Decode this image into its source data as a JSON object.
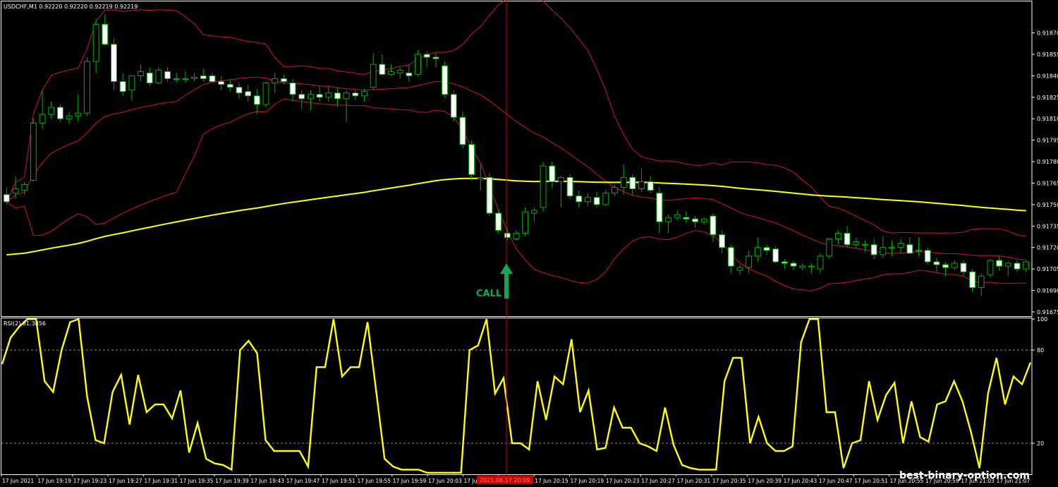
{
  "main_chart": {
    "symbol_line": "USDCHF,M1  0.92220 0.92220 0.92219 0.92219",
    "y_ticks": [
      "0.91870",
      "0.91855",
      "0.91840",
      "0.91825",
      "0.91810",
      "0.91795",
      "0.91780",
      "0.91765",
      "0.91750",
      "0.91735",
      "0.91720",
      "0.91705",
      "0.91690",
      "0.91675"
    ],
    "signal_label": "CALL",
    "watermark": "best-binary-option.com"
  },
  "x_axis": {
    "labels": [
      "17 Jun 2021",
      "17 Jun 19:19",
      "17 Jun 19:23",
      "17 Jun 19:27",
      "17 Jun 19:31",
      "17 Jun 19:35",
      "17 Jun 19:39",
      "17 Jun 19:43",
      "17 Jun 19:47",
      "17 Jun 19:51",
      "17 Jun 19:55",
      "17 Jun 19:59",
      "17 Jun 20:03",
      "17 Jun 20:07",
      "17 Jun 20:11",
      "17 Jun 20:15",
      "17 Jun 20:19",
      "17 Jun 20:23",
      "17 Jun 20:27",
      "17 Jun 20:31",
      "17 Jun 20:35",
      "17 Jun 20:39",
      "17 Jun 20:43",
      "17 Jun 20:47",
      "17 Jun 20:51",
      "17 Jun 20:55",
      "17 Jun 20:59",
      "17 Jun 21:03",
      "17 Jun 21:07"
    ],
    "cursor_label": "2021.06.17 20:09"
  },
  "rsi_panel": {
    "label": "RSI(2) 81.3856",
    "y_ticks": [
      "100",
      "80",
      "20"
    ]
  },
  "colors": {
    "background": "#000000",
    "bull_candle": "#00b000",
    "bear_candle": "#ffffff",
    "bollinger": "#d0142c",
    "moving_average": "#ffff00",
    "rsi_line": "#ffff00",
    "crosshair": "#c80000",
    "signal_arrow": "#13a655",
    "axis_text": "#ffffff"
  },
  "chart_data": [
    {
      "type": "candlestick",
      "title": "USDCHF,M1",
      "ylim": [
        0.91672,
        0.91892
      ],
      "indicators": [
        "Bollinger Bands",
        "Moving Average"
      ],
      "ohlc": [
        [
          0.91757,
          0.91762,
          0.9175,
          0.91752
        ],
        [
          0.91758,
          0.9177,
          0.91754,
          0.91761
        ],
        [
          0.9176,
          0.91766,
          0.91757,
          0.91764
        ],
        [
          0.91767,
          0.9181,
          0.91766,
          0.91807
        ],
        [
          0.91807,
          0.9183,
          0.91803,
          0.91813
        ],
        [
          0.91813,
          0.91822,
          0.9181,
          0.91818
        ],
        [
          0.91818,
          0.9182,
          0.91808,
          0.9181
        ],
        [
          0.9181,
          0.91815,
          0.91806,
          0.91812
        ],
        [
          0.91812,
          0.91827,
          0.91808,
          0.91814
        ],
        [
          0.91814,
          0.91853,
          0.91812,
          0.9185
        ],
        [
          0.9185,
          0.9188,
          0.91842,
          0.91876
        ],
        [
          0.91876,
          0.91883,
          0.91861,
          0.91862
        ],
        [
          0.91862,
          0.91866,
          0.9183,
          0.91836
        ],
        [
          0.91836,
          0.91842,
          0.91826,
          0.91829
        ],
        [
          0.9183,
          0.9184,
          0.91823,
          0.9184
        ],
        [
          0.9184,
          0.91848,
          0.91836,
          0.91843
        ],
        [
          0.91842,
          0.91846,
          0.91833,
          0.91835
        ],
        [
          0.91835,
          0.91846,
          0.91834,
          0.91844
        ],
        [
          0.91843,
          0.91846,
          0.91836,
          0.91838
        ],
        [
          0.91838,
          0.91842,
          0.91835,
          0.91838
        ],
        [
          0.91838,
          0.91843,
          0.91835,
          0.91838
        ],
        [
          0.91838,
          0.91842,
          0.91836,
          0.91839
        ],
        [
          0.9184,
          0.91845,
          0.91836,
          0.91838
        ],
        [
          0.9184,
          0.91842,
          0.91835,
          0.91836
        ],
        [
          0.91836,
          0.9184,
          0.9183,
          0.91834
        ],
        [
          0.91834,
          0.91838,
          0.91829,
          0.91832
        ],
        [
          0.91832,
          0.91835,
          0.91824,
          0.91828
        ],
        [
          0.91829,
          0.91834,
          0.91822,
          0.91826
        ],
        [
          0.91826,
          0.91831,
          0.91813,
          0.9182
        ],
        [
          0.9182,
          0.91836,
          0.91818,
          0.91835
        ],
        [
          0.91835,
          0.91842,
          0.91828,
          0.91838
        ],
        [
          0.91838,
          0.91841,
          0.91834,
          0.91836
        ],
        [
          0.91835,
          0.91838,
          0.91822,
          0.91827
        ],
        [
          0.91827,
          0.9183,
          0.91817,
          0.91824
        ],
        [
          0.91824,
          0.9183,
          0.91816,
          0.91827
        ],
        [
          0.91827,
          0.91833,
          0.91822,
          0.91825
        ],
        [
          0.91825,
          0.91833,
          0.91822,
          0.91828
        ],
        [
          0.91828,
          0.91832,
          0.91818,
          0.91824
        ],
        [
          0.91824,
          0.9183,
          0.91808,
          0.91828
        ],
        [
          0.91828,
          0.9183,
          0.91823,
          0.91826
        ],
        [
          0.91826,
          0.91831,
          0.91822,
          0.91829
        ],
        [
          0.91832,
          0.91856,
          0.9183,
          0.91848
        ],
        [
          0.91848,
          0.91855,
          0.9184,
          0.91841
        ],
        [
          0.91841,
          0.91848,
          0.9184,
          0.91843
        ],
        [
          0.91842,
          0.91846,
          0.91838,
          0.91844
        ],
        [
          0.91842,
          0.91848,
          0.91836,
          0.9184
        ],
        [
          0.91841,
          0.91858,
          0.9184,
          0.91855
        ],
        [
          0.91855,
          0.91857,
          0.91846,
          0.91853
        ],
        [
          0.91853,
          0.91856,
          0.91846,
          0.91852
        ],
        [
          0.91847,
          0.9185,
          0.91825,
          0.91827
        ],
        [
          0.91827,
          0.9183,
          0.91808,
          0.91811
        ],
        [
          0.91811,
          0.91815,
          0.91789,
          0.91792
        ],
        [
          0.91792,
          0.91795,
          0.91767,
          0.91771
        ],
        [
          0.91768,
          0.91778,
          0.9176,
          0.91769
        ],
        [
          0.91769,
          0.91772,
          0.91742,
          0.91744
        ],
        [
          0.91744,
          0.91747,
          0.9173,
          0.91732
        ],
        [
          0.9173,
          0.91734,
          0.91725,
          0.91727
        ],
        [
          0.91726,
          0.91732,
          0.91725,
          0.9173
        ],
        [
          0.9173,
          0.91748,
          0.91728,
          0.91745
        ],
        [
          0.91744,
          0.91748,
          0.91738,
          0.91746
        ],
        [
          0.91748,
          0.9178,
          0.91745,
          0.91777
        ],
        [
          0.91777,
          0.9178,
          0.91762,
          0.91766
        ],
        [
          0.91766,
          0.9177,
          0.91748,
          0.91769
        ],
        [
          0.91769,
          0.91771,
          0.91754,
          0.91756
        ],
        [
          0.91756,
          0.9176,
          0.91748,
          0.91752
        ],
        [
          0.91752,
          0.91758,
          0.91749,
          0.91755
        ],
        [
          0.91755,
          0.91759,
          0.91748,
          0.9175
        ],
        [
          0.9175,
          0.9176,
          0.91749,
          0.91758
        ],
        [
          0.91758,
          0.91764,
          0.91756,
          0.91762
        ],
        [
          0.91762,
          0.91778,
          0.91757,
          0.91769
        ],
        [
          0.91769,
          0.91771,
          0.91757,
          0.91761
        ],
        [
          0.91761,
          0.91775,
          0.91759,
          0.91766
        ],
        [
          0.91766,
          0.9177,
          0.91758,
          0.9176
        ],
        [
          0.91758,
          0.91762,
          0.9173,
          0.91738
        ],
        [
          0.91738,
          0.91743,
          0.9173,
          0.91741
        ],
        [
          0.91741,
          0.91746,
          0.91739,
          0.91743
        ],
        [
          0.91741,
          0.91745,
          0.91737,
          0.9174
        ],
        [
          0.9174,
          0.91742,
          0.91734,
          0.91738
        ],
        [
          0.91738,
          0.91741,
          0.91736,
          0.9174
        ],
        [
          0.91742,
          0.91744,
          0.91724,
          0.91729
        ],
        [
          0.91729,
          0.91732,
          0.91716,
          0.9172
        ],
        [
          0.9172,
          0.91722,
          0.91702,
          0.91707
        ],
        [
          0.91704,
          0.91708,
          0.91701,
          0.91706
        ],
        [
          0.91706,
          0.91718,
          0.91702,
          0.91714
        ],
        [
          0.91714,
          0.91727,
          0.9171,
          0.9172
        ],
        [
          0.9172,
          0.91722,
          0.91715,
          0.91718
        ],
        [
          0.91719,
          0.91721,
          0.91709,
          0.9171
        ],
        [
          0.9171,
          0.91712,
          0.91705,
          0.91709
        ],
        [
          0.91709,
          0.91711,
          0.91704,
          0.91707
        ],
        [
          0.91706,
          0.91709,
          0.91704,
          0.91707
        ],
        [
          0.91707,
          0.91709,
          0.91702,
          0.91707
        ],
        [
          0.91705,
          0.91716,
          0.91702,
          0.91714
        ],
        [
          0.91714,
          0.91726,
          0.91712,
          0.91726
        ],
        [
          0.91726,
          0.91732,
          0.91722,
          0.9173
        ],
        [
          0.9173,
          0.91735,
          0.9172,
          0.91722
        ],
        [
          0.91722,
          0.91727,
          0.91719,
          0.91724
        ],
        [
          0.91722,
          0.91725,
          0.91717,
          0.91722
        ],
        [
          0.91722,
          0.91726,
          0.91712,
          0.91715
        ],
        [
          0.91715,
          0.91728,
          0.91713,
          0.9172
        ],
        [
          0.9172,
          0.91725,
          0.91714,
          0.9172
        ],
        [
          0.9172,
          0.91726,
          0.91716,
          0.91723
        ],
        [
          0.91722,
          0.91727,
          0.91716,
          0.91716
        ],
        [
          0.91718,
          0.91727,
          0.91714,
          0.91718
        ],
        [
          0.91718,
          0.9172,
          0.91708,
          0.9171
        ],
        [
          0.9171,
          0.91713,
          0.91703,
          0.91708
        ],
        [
          0.91708,
          0.9171,
          0.917,
          0.91706
        ],
        [
          0.91706,
          0.91711,
          0.91704,
          0.91709
        ],
        [
          0.91709,
          0.91711,
          0.917,
          0.91703
        ],
        [
          0.91703,
          0.91705,
          0.91689,
          0.91692
        ],
        [
          0.91692,
          0.91702,
          0.91686,
          0.917
        ],
        [
          0.91701,
          0.91712,
          0.91699,
          0.91711
        ],
        [
          0.91711,
          0.91714,
          0.91704,
          0.91707
        ],
        [
          0.91707,
          0.9171,
          0.917,
          0.91709
        ],
        [
          0.91709,
          0.91711,
          0.91703,
          0.91705
        ],
        [
          0.91705,
          0.91711,
          0.91703,
          0.9171
        ]
      ]
    },
    {
      "type": "line",
      "title": "RSI(2) 81.3856",
      "ylim": [
        0,
        100
      ],
      "levels": [
        20,
        80
      ],
      "series": [
        {
          "name": "RSI(2)",
          "values": [
            71,
            88,
            95,
            100,
            100,
            60,
            53,
            80,
            98,
            100,
            50,
            22,
            20,
            53,
            64,
            32,
            64,
            40,
            45,
            45,
            36,
            54,
            14,
            33,
            10,
            7,
            6,
            3,
            80,
            86,
            78,
            22,
            15,
            15,
            15,
            15,
            5,
            69,
            69,
            100,
            63,
            69,
            69,
            98,
            54,
            10,
            5,
            3,
            3,
            3,
            1,
            1,
            1,
            1,
            1,
            80,
            83,
            100,
            52,
            62,
            20,
            20,
            16,
            60,
            35,
            63,
            58,
            87,
            40,
            54,
            16,
            17,
            43,
            30,
            30,
            20,
            18,
            15,
            43,
            19,
            6,
            4,
            3,
            3,
            3,
            60,
            75,
            75,
            20,
            37,
            20,
            15,
            15,
            18,
            85,
            100,
            100,
            40,
            40,
            4,
            20,
            22,
            60,
            35,
            51,
            59,
            20,
            47,
            24,
            21,
            45,
            47,
            60,
            47,
            27,
            4,
            52,
            75,
            45,
            63,
            58,
            72
          ]
        }
      ]
    }
  ]
}
